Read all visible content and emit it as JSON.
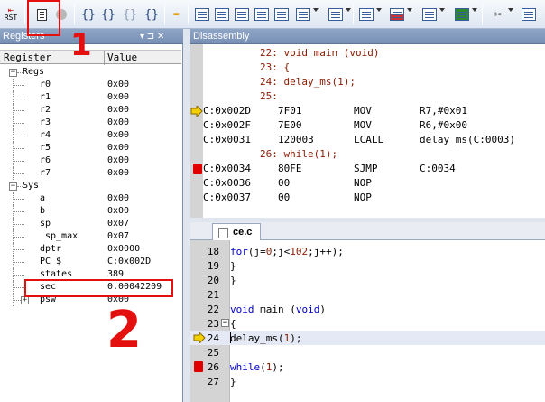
{
  "toolbar": {
    "rst_label": "RST",
    "brace_buttons": [
      "{}",
      "{}",
      "{}",
      "{}"
    ]
  },
  "registers": {
    "title": "Registers",
    "pin_glyph": "▾ ⊐ ✕",
    "col_register": "Register",
    "col_value": "Value",
    "groups": [
      {
        "name": "Regs",
        "items": [
          {
            "name": "r0",
            "value": "0x00"
          },
          {
            "name": "r1",
            "value": "0x00"
          },
          {
            "name": "r2",
            "value": "0x00"
          },
          {
            "name": "r3",
            "value": "0x00"
          },
          {
            "name": "r4",
            "value": "0x00"
          },
          {
            "name": "r5",
            "value": "0x00"
          },
          {
            "name": "r6",
            "value": "0x00"
          },
          {
            "name": "r7",
            "value": "0x00"
          }
        ]
      },
      {
        "name": "Sys",
        "items": [
          {
            "name": "a",
            "value": "0x00"
          },
          {
            "name": "b",
            "value": "0x00"
          },
          {
            "name": "sp",
            "value": "0x07"
          },
          {
            "name": "sp_max",
            "value": "0x07"
          },
          {
            "name": "dptr",
            "value": "0x0000"
          },
          {
            "name": "PC  $",
            "value": "C:0x002D"
          },
          {
            "name": "states",
            "value": "389"
          },
          {
            "name": "sec",
            "value": "0.00042209"
          },
          {
            "name": "psw",
            "value": "0x00"
          }
        ]
      }
    ]
  },
  "disassembly": {
    "title": "Disassembly",
    "lines": [
      {
        "kind": "src",
        "text": "22: void main (void)"
      },
      {
        "kind": "src",
        "text": "23: {"
      },
      {
        "kind": "src",
        "text": "24: delay_ms(1);"
      },
      {
        "kind": "src",
        "text": "25:"
      },
      {
        "kind": "asm",
        "addr": "C:0x002D",
        "bytes": "7F01",
        "op": "MOV",
        "args": "R7,#0x01",
        "mark": "arrow"
      },
      {
        "kind": "asm",
        "addr": "C:0x002F",
        "bytes": "7E00",
        "op": "MOV",
        "args": "R6,#0x00",
        "mark": ""
      },
      {
        "kind": "asm",
        "addr": "C:0x0031",
        "bytes": "120003",
        "op": "LCALL",
        "args": "delay_ms(C:0003)",
        "mark": ""
      },
      {
        "kind": "src",
        "text": "26: while(1);"
      },
      {
        "kind": "asm",
        "addr": "C:0x0034",
        "bytes": "80FE",
        "op": "SJMP",
        "args": "C:0034",
        "mark": "bp"
      },
      {
        "kind": "asm",
        "addr": "C:0x0036",
        "bytes": "00",
        "op": "NOP",
        "args": "",
        "mark": ""
      },
      {
        "kind": "asm",
        "addr": "C:0x0037",
        "bytes": "00",
        "op": "NOP",
        "args": "",
        "mark": ""
      }
    ]
  },
  "editor": {
    "tab_label": "ce.c",
    "lines": [
      {
        "num": "18",
        "code": "        for(j=0;j<102;j++);",
        "mark": "",
        "fold": ""
      },
      {
        "num": "19",
        "code": "    }",
        "mark": "",
        "fold": ""
      },
      {
        "num": "20",
        "code": "}",
        "mark": "",
        "fold": ""
      },
      {
        "num": "21",
        "code": "",
        "mark": "",
        "fold": ""
      },
      {
        "num": "22",
        "code": "void main (void)",
        "mark": "",
        "fold": ""
      },
      {
        "num": "23",
        "code": "{",
        "mark": "",
        "fold": "-"
      },
      {
        "num": "24",
        "code": "delay_ms(1);",
        "mark": "arrow",
        "fold": ""
      },
      {
        "num": "25",
        "code": "",
        "mark": "",
        "fold": ""
      },
      {
        "num": "26",
        "code": "while(1);",
        "mark": "bp",
        "fold": ""
      },
      {
        "num": "27",
        "code": "}",
        "mark": "",
        "fold": ""
      }
    ]
  },
  "annotations": {
    "label_1": "1",
    "label_2": "2",
    "color": "#e41010"
  }
}
